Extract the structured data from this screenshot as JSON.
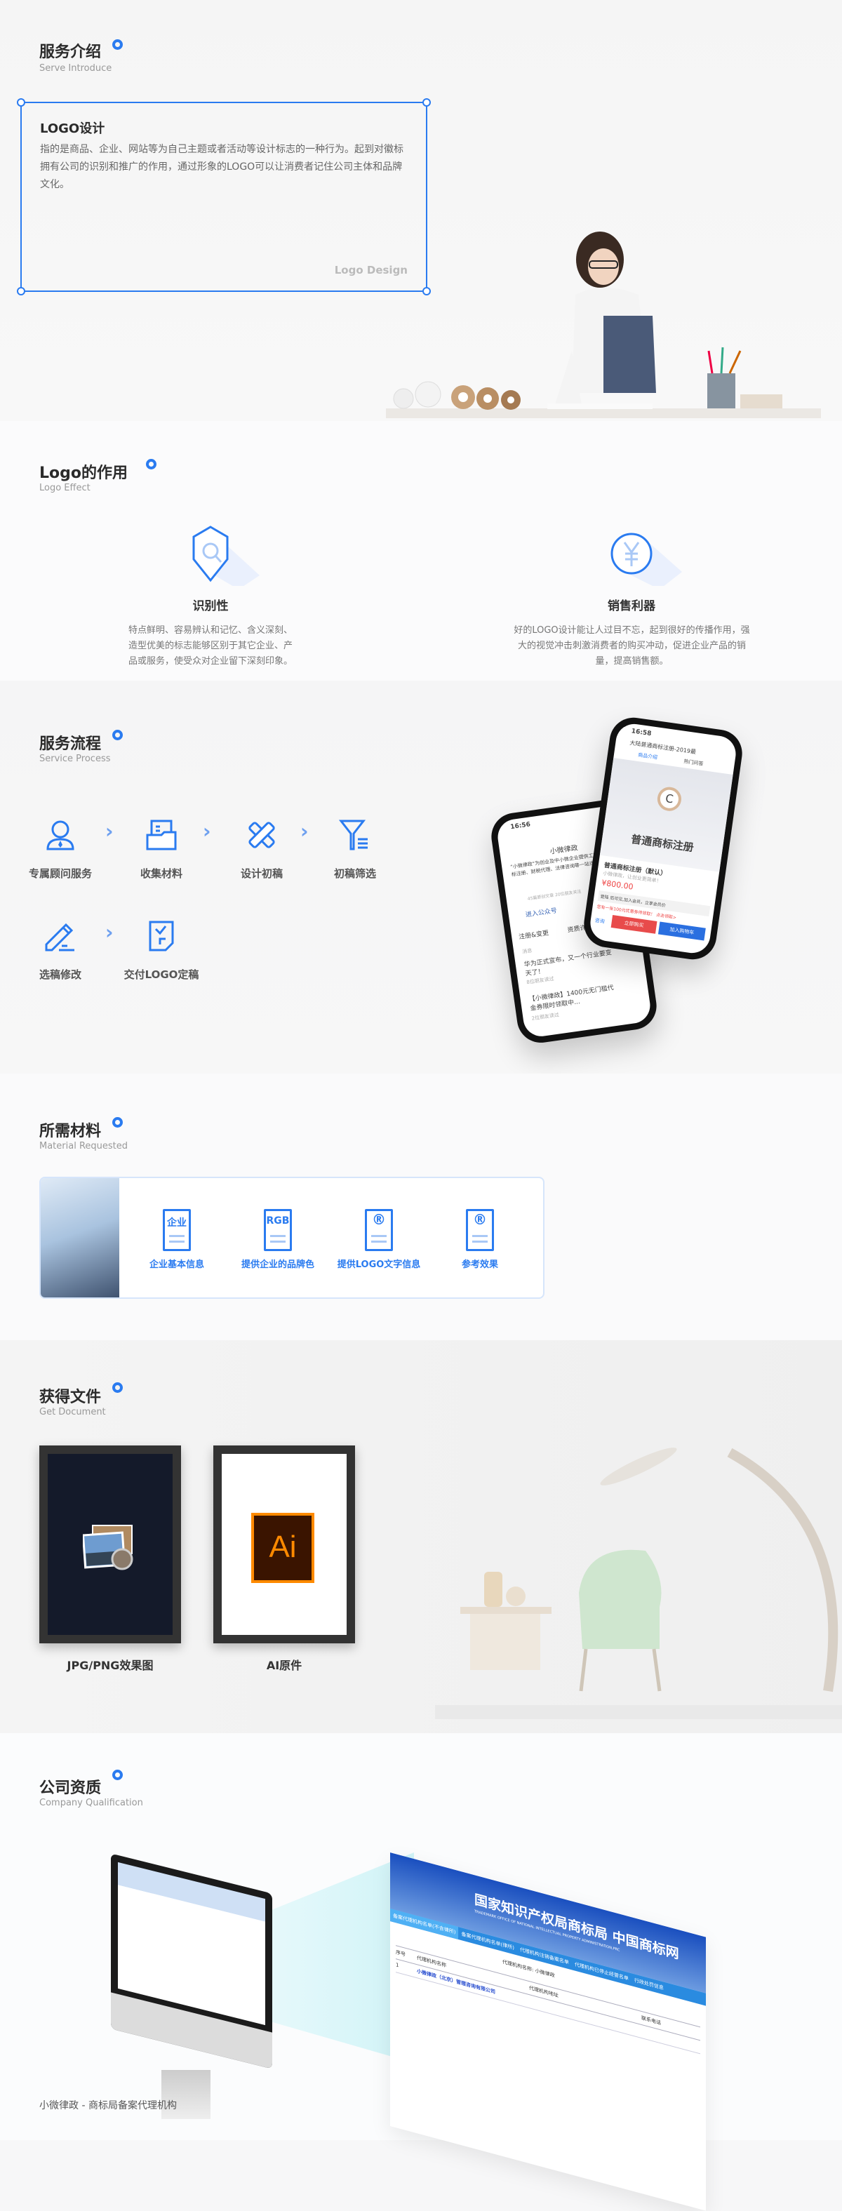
{
  "intro": {
    "title": "服务介绍",
    "subtitle": "Serve Introduce",
    "card_title": "LOGO设计",
    "card_text": "指的是商品、企业、网站等为自己主题或者活动等设计标志的一种行为。起到对徽标拥有公司的识别和推广的作用，通过形象的LOGO可以让消费者记住公司主体和品牌文化。",
    "card_watermark": "Logo Design"
  },
  "effect": {
    "title": "Logo的作用",
    "subtitle": "Logo Effect",
    "items": [
      {
        "icon": "shield-search-icon",
        "title": "识别性",
        "text": "特点鲜明、容易辨认和记忆、含义深刻、造型优美的标志能够区别于其它企业、产品或服务，使受众对企业留下深刻印象。"
      },
      {
        "icon": "yuan-coin-icon",
        "title": "销售利器",
        "text": "好的LOGO设计能让人过目不忘，起到很好的传播作用，强大的视觉冲击刺激消费者的购买冲动，促进企业产品的销量，提高销售额。"
      }
    ]
  },
  "process": {
    "title": "服务流程",
    "subtitle": "Service Process",
    "steps": [
      {
        "icon": "consultant-icon",
        "label": "专属顾问服务"
      },
      {
        "icon": "folder-document-icon",
        "label": "收集材料"
      },
      {
        "icon": "pencil-ruler-icon",
        "label": "设计初稿"
      },
      {
        "icon": "filter-icon",
        "label": "初稿筛选"
      },
      {
        "icon": "edit-icon",
        "label": "选稿修改"
      },
      {
        "icon": "check-document-icon",
        "label": "交付LOGO定稿"
      }
    ],
    "phone_back": {
      "time": "16:56",
      "account": "小微律政",
      "intro": "“小微律政”为创业及中小微企业提供工商注册、商标注册、财税代理、法律咨询等一站式企业服务。",
      "stats": "45篇原创文章  20位朋友关注",
      "enter": "进入公众号",
      "tabs": [
        "注册&变更",
        "资质许可"
      ],
      "news_label": "消息",
      "news": [
        "华为正式宣布，又一个行业要变天了！",
        "【小微律政】1400元无门槛代金券限时领取中..."
      ],
      "news_meta": [
        "8位朋友读过",
        "2位朋友读过"
      ]
    },
    "phone_front": {
      "time": "16:58",
      "page_title": "大陆普通商标注册-2019最",
      "tabs": [
        "商品介绍",
        "热门问答"
      ],
      "banner": "普通商标注册",
      "product": "普通商标注册（默认）",
      "slogan": "小微律政，让创业更简单！",
      "price": "¥800.00",
      "member": "登陆 后可见,加入会员，立享会员价",
      "coupon": "您有一张100元优惠券待领取！ 点击领取>",
      "service": "咨询",
      "buy": "立即购买",
      "cart": "加入购物车"
    }
  },
  "materials": {
    "title": "所需材料",
    "subtitle": "Material Requested",
    "items": [
      {
        "badge": "企业",
        "label": "企业基本信息"
      },
      {
        "badge": "RGB",
        "label": "提供企业的品牌色"
      },
      {
        "badge": "®",
        "label": "提供LOGO文字信息"
      },
      {
        "badge": "®",
        "label": "参考效果"
      }
    ]
  },
  "documents": {
    "title": "获得文件",
    "subtitle": "Get Document",
    "items": [
      {
        "label": "JPG/PNG效果图",
        "icon": "preview-photo-icon"
      },
      {
        "label": "AI原件",
        "icon": "illustrator-icon",
        "icon_text": "Ai"
      }
    ],
    "ai_bg": "#3a1400",
    "ai_accent": "#ff8a00"
  },
  "qualification": {
    "title": "公司资质",
    "subtitle": "Company Qualification",
    "site_title": "国家知识产权局商标局 中国商标网",
    "site_sub": "TRADEMARK OFFICE OF NATIONAL INTELLECTUAL PROPERTY ADMINISTRATION,PRC",
    "tabs": [
      "备案代理机构名单(不含律所)",
      "备案代理机构名单(律所)",
      "代理机构注销备案名单",
      "代理机构已停止经营名单",
      "行政处罚信息"
    ],
    "search_label": "代理机构名称: 小微律政",
    "col_no": "序号",
    "col_name": "代理机构名称",
    "col_addr": "代理机构地址",
    "col_tel": "联系电话",
    "row_no": "1",
    "row_name": "小微律政（北京）管理咨询有限公司",
    "footer_text": "小微律政 - 商标局备案代理机构"
  },
  "colors": {
    "accent": "#2a7bf0",
    "light_accent": "#a9c8f6"
  }
}
